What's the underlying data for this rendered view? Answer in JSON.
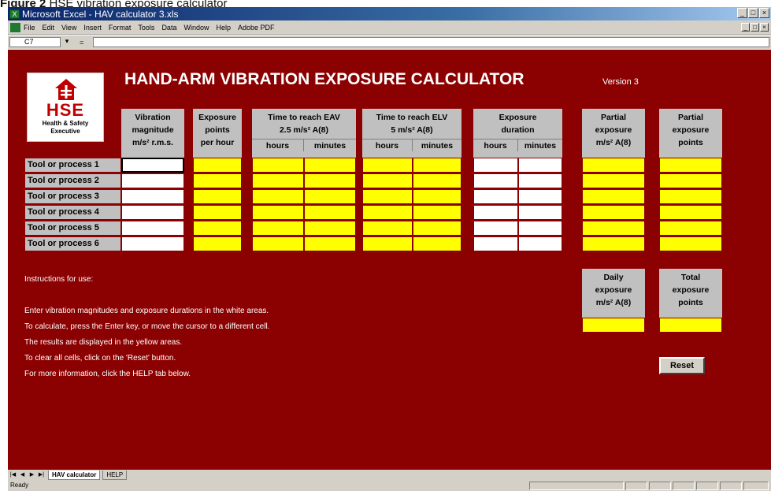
{
  "caption": {
    "label": "Figure 2",
    "text": "HSE vibration exposure calculator"
  },
  "window": {
    "app": "Microsoft Excel",
    "title": "Microsoft Excel - HAV calculator 3.xls"
  },
  "menu": [
    "File",
    "Edit",
    "View",
    "Insert",
    "Format",
    "Tools",
    "Data",
    "Window",
    "Help",
    "Adobe PDF"
  ],
  "formula_bar": {
    "cell_ref": "C7",
    "equals": "="
  },
  "logo": {
    "text": "HSE",
    "subtitle_line1": "Health & Safety",
    "subtitle_line2": "Executive"
  },
  "calculator": {
    "title": "HAND-ARM VIBRATION EXPOSURE CALCULATOR",
    "version": "Version 3",
    "headers": {
      "vibration": [
        "Vibration",
        "magnitude",
        "m/s² r.m.s."
      ],
      "exposure_points": [
        "Exposure",
        "points",
        "per hour"
      ],
      "eav": [
        "Time to reach EAV",
        "2.5 m/s² A(8)"
      ],
      "elv": [
        "Time to reach ELV",
        "5 m/s² A(8)"
      ],
      "duration": [
        "Exposure",
        "duration"
      ],
      "partial_exposure": [
        "Partial",
        "exposure",
        "m/s² A(8)"
      ],
      "partial_points": [
        "Partial",
        "exposure",
        "points"
      ],
      "hours": "hours",
      "minutes": "minutes"
    },
    "rows": [
      "Tool or process 1",
      "Tool or process 2",
      "Tool or process 3",
      "Tool or process 4",
      "Tool or process 5",
      "Tool or process 6"
    ],
    "daily_exposure": [
      "Daily",
      "exposure",
      "m/s² A(8)"
    ],
    "total_points": [
      "Total",
      "exposure",
      "points"
    ],
    "instructions": [
      "Instructions for use:",
      "Enter vibration magnitudes and exposure durations in the white areas.",
      "To calculate, press the Enter key, or move the cursor to a different cell.",
      "The results are displayed in the yellow areas.",
      "To clear all cells, click on the 'Reset' button.",
      "For more information, click the HELP tab below."
    ],
    "reset_label": "Reset"
  },
  "tabs": [
    {
      "label": "HAV calculator",
      "active": true
    },
    {
      "label": "HELP",
      "active": false
    }
  ],
  "status": "Ready",
  "colors": {
    "sheet_bg": "#8b0000",
    "input": "#ffffff",
    "output": "#ffff00",
    "header": "#c0c0c0"
  }
}
